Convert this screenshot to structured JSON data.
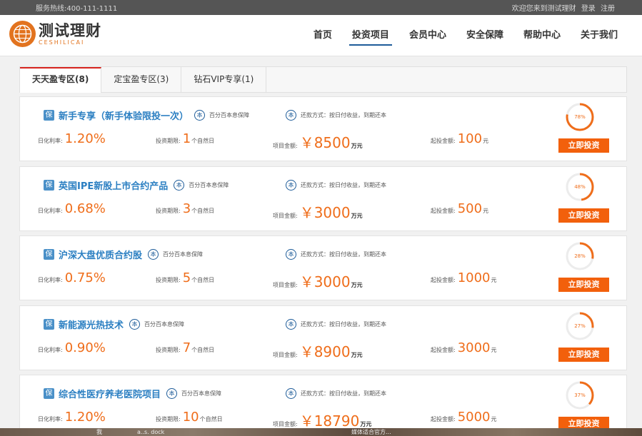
{
  "topbar": {
    "hotline": "服务热线:400-111-1111",
    "welcome": "欢迎您来到测试理财",
    "login": "登录",
    "register": "注册"
  },
  "logo": {
    "title": "测试理财",
    "subtitle": "CESHILICAI",
    "icon": "globe-icon"
  },
  "nav": {
    "items": [
      "首页",
      "投资项目",
      "会员中心",
      "安全保障",
      "帮助中心",
      "关于我们"
    ],
    "active_index": 1
  },
  "tabs": {
    "items": [
      "天天盈专区(8)",
      "定宝盈专区(3)",
      "钻石VIP专享(1)"
    ],
    "active_index": 0
  },
  "labels": {
    "bao": "保",
    "ben": "本",
    "guarantee": "百分百本息保障",
    "repay_method": "还款方式：按日付收益，到期还本",
    "rate": "日化利率:",
    "period": "投资期限:",
    "period_unit": "个自然日",
    "amount": "项目金额:",
    "amount_prefix": "￥",
    "amount_unit": "万元",
    "min": "起投金额:",
    "min_unit": "元",
    "invest_button": "立即投资"
  },
  "products": [
    {
      "name": "新手专享（新手体验限投一次）",
      "rate": "1.20%",
      "period": "1",
      "amount": "8500",
      "min": "100",
      "progress": 78,
      "progress_label": "78%"
    },
    {
      "name": "英国IPE新股上市合约产品",
      "rate": "0.68%",
      "period": "3",
      "amount": "3000",
      "min": "500",
      "progress": 48,
      "progress_label": "48%"
    },
    {
      "name": "沪深大盘优质合约股",
      "rate": "0.75%",
      "period": "5",
      "amount": "3000",
      "min": "1000",
      "progress": 28,
      "progress_label": "28%"
    },
    {
      "name": "新能源光热技术",
      "rate": "0.90%",
      "period": "7",
      "amount": "8900",
      "min": "3000",
      "progress": 27,
      "progress_label": "27%"
    },
    {
      "name": "综合性医疗养老医院项目",
      "rate": "1.20%",
      "period": "10",
      "amount": "18790",
      "min": "5000",
      "progress": 37,
      "progress_label": "37%"
    }
  ],
  "taskbar": {
    "item1": "我",
    "item2": "a..s. dock",
    "item3": "媒体适合官方..."
  },
  "colors": {
    "accent": "#ef6d1a",
    "button": "#f2600c",
    "title_blue": "#2b7fc2",
    "tab_active": "#d7241e",
    "nav_underline": "#1e5c99"
  }
}
